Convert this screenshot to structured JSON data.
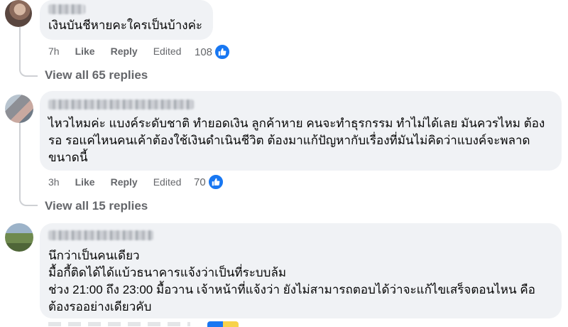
{
  "comments": [
    {
      "text": "เงินบันชีหายคะใครเป็นบ้างค่ะ",
      "time": "7h",
      "like_label": "Like",
      "reply_label": "Reply",
      "edited_label": "Edited",
      "reaction_count": "108",
      "view_replies": "View all 65 replies"
    },
    {
      "text": "ไหวไหมค่ะ แบงค์ระดับชาติ ทำยอดเงิน ลูกค้าหาย คนจะทำธุรกรรม ทำไม่ได้เลย มันควรไหม ต้อง\nรอ รอแค่ไหนคนเค้าต้องใช้เงินดำเนินชีวิต ต้องมาแก้ปัญหากับเรื่องที่มันไม่คิดว่าแบงค์จะพลาด\nขนาดนี้",
      "time": "3h",
      "like_label": "Like",
      "reply_label": "Reply",
      "edited_label": "Edited",
      "reaction_count": "70",
      "view_replies": "View all 15 replies"
    },
    {
      "text": "นึกว่าเป็นคนเดียว\nมื้อกี้ติดได้ได้แบ้วธนาคารแจ้งว่าเป็นที่ระบบล้ม\nช่วง 21:00 ถึง 23:00 มื้อวาน เจ้าหน้าที่แจ้งว่า ยังไม่สามารถตอบได้ว่าจะแก้ไขเสร็จตอนไหน คือ\nต้องรออย่างเดียวคับ"
    }
  ],
  "colors": {
    "bubble": "#f0f2f5",
    "meta_text": "#65676b",
    "like_blue": "#1877f2"
  }
}
